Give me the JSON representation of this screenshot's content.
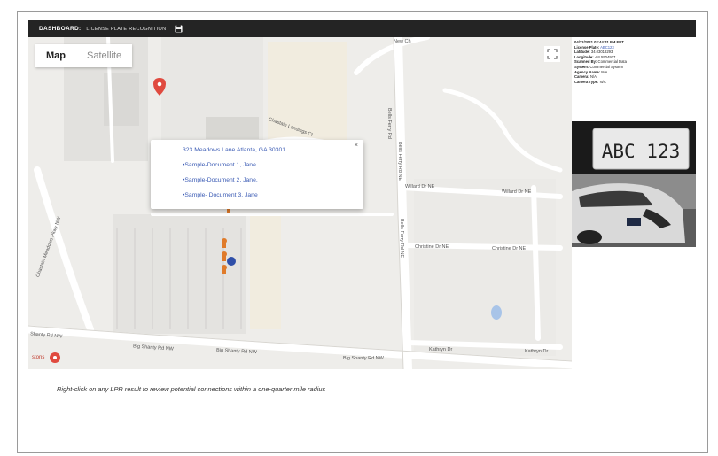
{
  "titlebar": {
    "title": "DASHBOARD:",
    "subtitle": "LICENSE PLATE RECOGNITION",
    "save_icon": "save-icon"
  },
  "map": {
    "map_type_selected": "Map",
    "map_type_options": [
      "Map",
      "Satellite"
    ],
    "streets": {
      "bells_ferry_1": "Bells Ferry Rd",
      "bells_ferry_2": "Bells Ferry Rd NE",
      "bells_ferry_3": "Bells Ferry Rd NE",
      "chastain_meadows": "Chastain Meadows Pkwy NW",
      "big_shanty_1": "Big Shanty Rd NW",
      "big_shanty_2": "Big Shanty Rd NW",
      "big_shanty_3": "Big Shanty Rd NW",
      "shanty_rd_left": "Shanty Rd NW",
      "willard_1": "Willard Dr NE",
      "willard_2": "Willard Dr NE",
      "christine_1": "Christine Dr NE",
      "christine_2": "Christine Dr NE",
      "kathryn_1": "Kathryn Dr",
      "kathryn_2": "Kathryn Dr",
      "chastain_ct": "Chastain Landings Ct",
      "new_ch": "New Ch",
      "place_label": "stons"
    },
    "popup": {
      "address": "323 Meadows Lane Atlanta, GA 30301",
      "documents": [
        "•Sample-Document 1, Jane",
        "•Sample-Document 2, Jane,",
        "•Sample- Document 3, Jane"
      ],
      "close": "×"
    }
  },
  "details": {
    "datetime": "04/22/2021 02:44:41 PM EDT",
    "rows": [
      {
        "label": "License Plate:",
        "value": "ABC123"
      },
      {
        "label": "Latitude:",
        "value": "34.03018293"
      },
      {
        "label": "Longitude:",
        "value": "-84.5504927"
      },
      {
        "label": "Scanned By:",
        "value": "Commercial Data"
      },
      {
        "label": "System:",
        "value": "Commercial System"
      },
      {
        "label": "Agency Name:",
        "value": "N/A"
      },
      {
        "label": "Camera:",
        "value": "N/A"
      },
      {
        "label": "Camera Type:",
        "value": "N/A"
      }
    ],
    "plate_text": "ABC 123"
  },
  "caption": "Right-click on any LPR result to review potential connections within a one-quarter mile radius",
  "colors": {
    "titlebar_bg": "#242424",
    "link_blue": "#3b5bb4",
    "pin_red": "#e04a3f",
    "marker_orange": "#e07b2a",
    "marker_blue": "#2f4fa8"
  }
}
